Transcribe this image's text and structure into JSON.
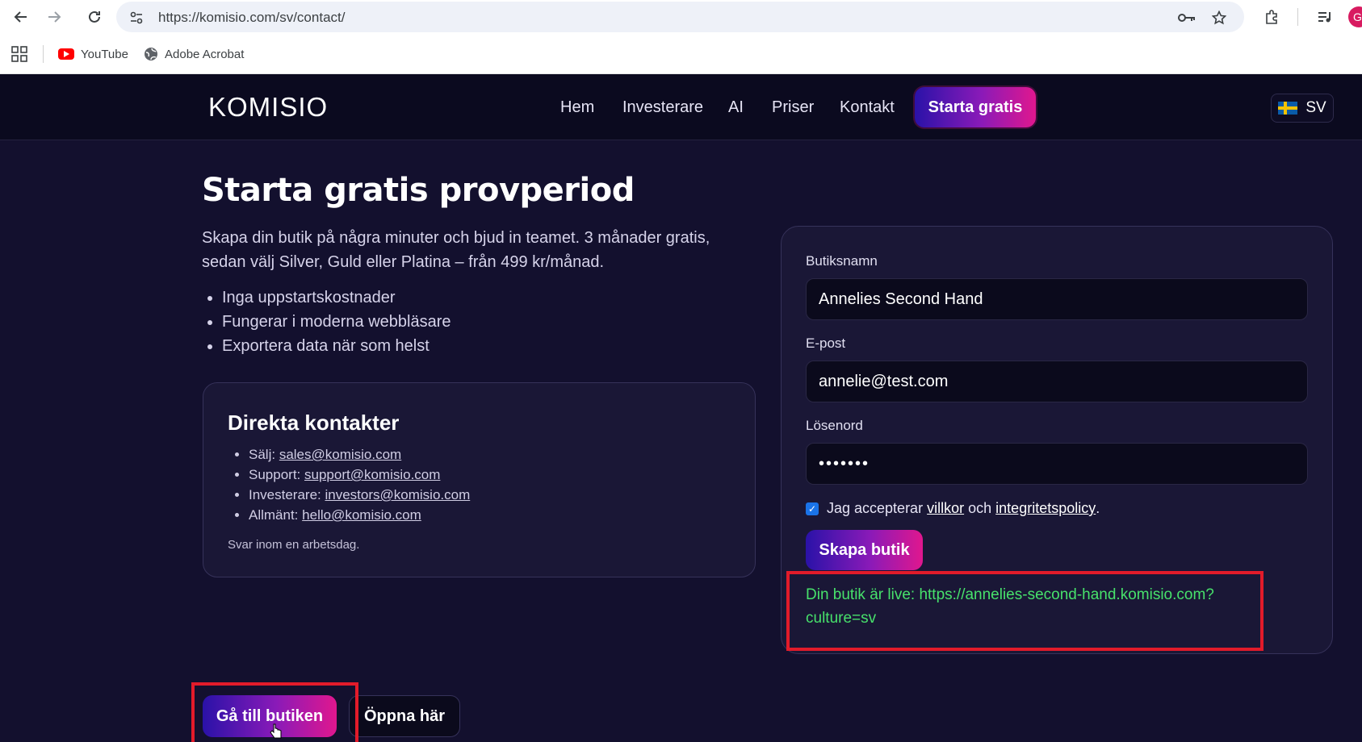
{
  "browser": {
    "url": "https://komisio.com/sv/contact/",
    "bookmarks": [
      {
        "label": "YouTube",
        "icon": "youtube-icon"
      },
      {
        "label": "Adobe Acrobat",
        "icon": "globe-icon"
      }
    ],
    "profile_initial": "G"
  },
  "header": {
    "logo": "KOMISIO",
    "nav": [
      "Hem",
      "Investerare",
      "AI",
      "Priser",
      "Kontakt"
    ],
    "cta": "Starta gratis",
    "language": "SV"
  },
  "main": {
    "title": "Starta gratis provperiod",
    "intro": "Skapa din butik på några minuter och bjud in teamet. 3 månader gratis, sedan välj Silver, Guld eller Platina – från 499 kr/månad.",
    "bullets": [
      "Inga uppstartskostnader",
      "Fungerar i moderna webbläsare",
      "Exportera data när som helst"
    ],
    "contacts": {
      "title": "Direkta kontakter",
      "items": [
        {
          "label": "Sälj:",
          "email": "sales@komisio.com"
        },
        {
          "label": "Support:",
          "email": "support@komisio.com"
        },
        {
          "label": "Investerare:",
          "email": "investors@komisio.com"
        },
        {
          "label": "Allmänt:",
          "email": "hello@komisio.com"
        }
      ],
      "note": "Svar inom en arbetsdag."
    }
  },
  "form": {
    "store_name_label": "Butiksnamn",
    "store_name_value": "Annelies Second Hand",
    "email_label": "E-post",
    "email_value": "annelie@test.com",
    "password_label": "Lösenord",
    "password_value": "•••••••",
    "terms_prefix": "Jag accepterar",
    "terms_link": "villkor",
    "terms_and": "och",
    "privacy_link": "integritetspolicy",
    "terms_suffix": ".",
    "submit": "Skapa butik",
    "live_message": "Din butik är live: https://annelies-second-hand.komisio.com?culture=sv"
  },
  "actions": {
    "goto_store": "Gå till butiken",
    "open_here": "Öppna här"
  }
}
